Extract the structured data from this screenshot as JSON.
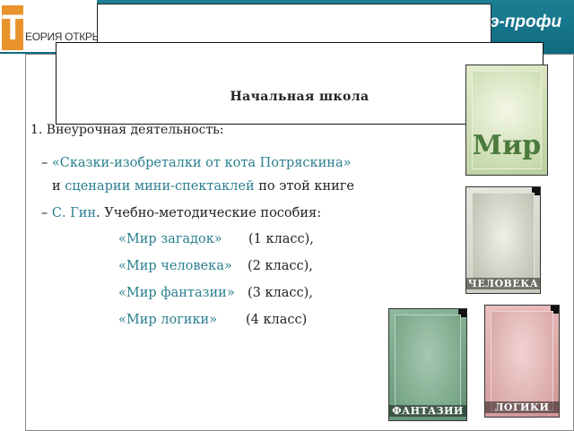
{
  "header": {
    "logo_letter": "Т",
    "logo_text": "ЕОРИЯ ОТКРЫТЫХ",
    "brand": "э-профи"
  },
  "title": "Начальная школа",
  "item_heading": "1.  Внеурочная деятельность:",
  "lines": {
    "l1_dash": "–",
    "l1_hl": "«Сказки-изобреталки от кота Потряскина»",
    "l2_plain": "и ",
    "l2_hl": "сценарии мини-спектаклей",
    "l2_rest": " по этой книге",
    "l3_dash": "–",
    "l3_hl": "С. Гин",
    "l3_rest": ". Учебно-методические пособия:"
  },
  "manuals": [
    {
      "title": "«Мир загадок»",
      "grade": "(1 класс),"
    },
    {
      "title": "«Мир человека»",
      "grade": "(2 класс),"
    },
    {
      "title": "«Мир фантазии»",
      "grade": "(3 класс),"
    },
    {
      "title": "«Мир логики»",
      "grade": "(4 класс)"
    }
  ],
  "books": [
    {
      "word": "Мир",
      "color": "#c8d8a8"
    },
    {
      "word": "ЧЕЛОВЕКА",
      "color": "#d0d6cc"
    },
    {
      "word": "ФАНТАЗИИ",
      "color": "#6f9f80"
    },
    {
      "word": "ЛОГИКИ",
      "color": "#d9a4a4"
    }
  ]
}
